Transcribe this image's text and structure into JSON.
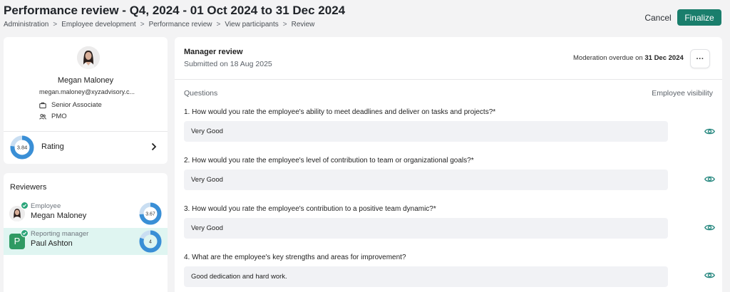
{
  "header": {
    "title": "Performance review - Q4, 2024 - 01 Oct 2024 to 31 Dec 2024",
    "breadcrumb": [
      "Administration",
      "Employee development",
      "Performance review",
      "View participants",
      "Review"
    ],
    "cancel_label": "Cancel",
    "finalize_label": "Finalize"
  },
  "profile": {
    "name": "Megan Maloney",
    "email": "megan.maloney@xyzadvisory.c...",
    "position": "Senior Associate",
    "department": "PMO",
    "rating_value": "3.84",
    "rating_fraction": 0.768,
    "rating_label": "Rating"
  },
  "reviewers": {
    "title": "Reviewers",
    "items": [
      {
        "role": "Employee",
        "name": "Megan Maloney",
        "score": "3.67",
        "fraction": 0.734,
        "avatar": "photo"
      },
      {
        "role": "Reporting manager",
        "name": "Paul Ashton",
        "score": "4",
        "fraction": 0.8,
        "avatar": "P"
      }
    ]
  },
  "review": {
    "title": "Manager review",
    "submitted": "Submitted on 18 Aug 2025",
    "moderation_prefix": "Moderation overdue on",
    "moderation_date": "31 Dec 2024",
    "more_label": "···",
    "questions_header": "Questions",
    "visibility_header": "Employee visibility",
    "questions": [
      {
        "text": "1. How would you rate the employee's ability to meet deadlines and deliver on tasks and projects?*",
        "answer": "Very Good"
      },
      {
        "text": "2. How would you rate the employee's level of contribution to team or organizational goals?*",
        "answer": "Very Good"
      },
      {
        "text": "3. How would you rate the employee's contribution to a positive team dynamic?*",
        "answer": "Very Good"
      },
      {
        "text": "4. What are the employee's key strengths and areas for improvement?",
        "answer": "Good dedication and hard work."
      }
    ]
  },
  "colors": {
    "accent": "#1a7e6c",
    "ring": "#3a8fd6",
    "ring_track": "#c9def2",
    "highlight_row": "#dff5f1",
    "eye_icon": "#2b8a82"
  }
}
